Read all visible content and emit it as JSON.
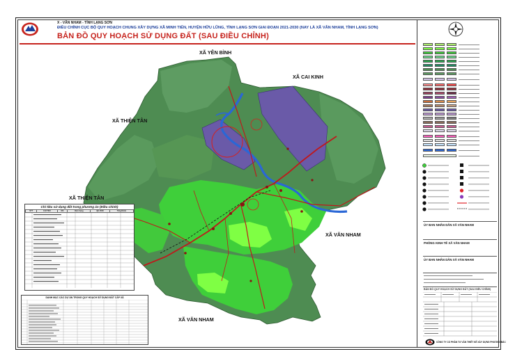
{
  "header": {
    "authority": "X - VĂN NHAM - TỈNH LẠNG SƠN",
    "subtitle": "ĐIỀU CHỈNH CỤC BỘ QUY HOẠCH CHUNG XÂY DỰNG XÃ MINH TIẾN, HUYỆN HỮU LŨNG, TỈNH LẠNG SƠN GIAI ĐOẠN 2021-2030 (NAY LÀ XÃ VĂN NHAM, TỈNH LẠNG SƠN)",
    "title": "BẢN ĐỒ QUY HOẠCH SỬ DỤNG ĐẤT (SAU ĐIỀU CHỈNH)"
  },
  "places": {
    "yen_binh": "XÃ YÊN BÌNH",
    "cai_kinh": "XÃ CAI KINH",
    "thien_tan_top": "XÃ THIỆN TÂN",
    "thien_tan_mid": "XÃ THIỆN TÂN",
    "van_nham_right": "XÃ VĂN NHAM",
    "van_nham_bottom": "XÃ VĂN NHAM"
  },
  "tables": {
    "stats_title": "Chỉ tiêu sử dụng đất trong phương án (Điều chỉnh)",
    "project_title": "DANH MỤC CÁC DỰ ÁN TRONG QUY HOẠCH SỬ DỤNG ĐẤT CẤP XÃ",
    "stats_header": [
      "STT",
      "CHỈ TIÊU",
      "MÃ",
      "Hiện trạng",
      "QH 2030",
      "Tăng/Giảm"
    ]
  },
  "title_block": {
    "approval": "ỦY BAN NHÂN DÂN XÃ VĂN NHAM",
    "agency": "PHÒNG KINH TẾ XÃ VĂN NHAM",
    "owner": "ỦY BAN NHÂN DÂN XÃ VĂN NHAM",
    "drawing_name": "BẢN ĐỒ QUY HOẠCH SỬ DỤNG ĐẤT (SAU ĐIỀU CHỈNH)",
    "company": "CÔNG TY CỔ PHẦN TƯ VẤN THIẾT KẾ XÂY DỰNG PHƯƠNG BẮC"
  },
  "colors": {
    "forest_dark": "#4e8c52",
    "forest_light": "#5e9c62",
    "agri_green": "#3fcf3a",
    "bright_green": "#7fff44",
    "river": "#2a67d6",
    "purple_zone": "#6a5aa8",
    "road": "#c0181b",
    "title_red": "#c6231d",
    "text_blue": "#1c3f9a"
  }
}
